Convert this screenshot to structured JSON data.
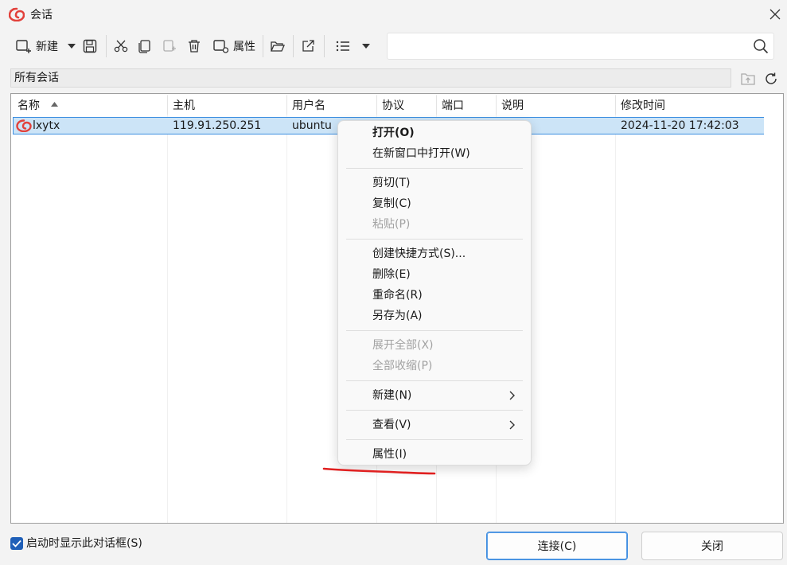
{
  "window": {
    "title": "会话",
    "accent_color": "#1f5fb8",
    "logo_icon": "xshell-shell-icon",
    "close_icon": "close-icon"
  },
  "toolbar": {
    "new_label": "新建",
    "properties_label": "属性",
    "search_value": "",
    "icons": [
      "new-session-icon",
      "dropdown-arrow-icon",
      "save-icon",
      "cut-icon",
      "copy-icon",
      "paste-icon",
      "delete-icon",
      "properties-icon",
      "open-folder-icon",
      "export-icon",
      "list-view-icon",
      "dropdown-arrow-icon",
      "search-icon"
    ]
  },
  "path_bar": {
    "label": "所有会话",
    "icons": [
      "up-folder-icon",
      "refresh-icon"
    ]
  },
  "table": {
    "columns": [
      "名称",
      "主机",
      "用户名",
      "协议",
      "端口",
      "说明",
      "修改时间"
    ],
    "sort_column": "名称",
    "sort_direction": "ascending",
    "rows": [
      {
        "name": "lxytx",
        "host": "119.91.250.251",
        "user": "ubuntu",
        "protocol": "",
        "port": "",
        "description": "",
        "modified": "2024-11-20 17:42:03",
        "icon": "xshell-session-icon",
        "selected": true
      }
    ]
  },
  "context_menu": {
    "items": [
      {
        "label": "打开(O)",
        "bold": true,
        "disabled": false
      },
      {
        "label": "在新窗口中打开(W)",
        "disabled": false
      },
      {
        "separator": true
      },
      {
        "label": "剪切(T)",
        "disabled": false
      },
      {
        "label": "复制(C)",
        "disabled": false
      },
      {
        "label": "粘贴(P)",
        "disabled": true
      },
      {
        "separator": true
      },
      {
        "label": "创建快捷方式(S)...",
        "disabled": false
      },
      {
        "label": "删除(E)",
        "disabled": false
      },
      {
        "label": "重命名(R)",
        "disabled": false
      },
      {
        "label": "另存为(A)",
        "disabled": false
      },
      {
        "separator": true
      },
      {
        "label": "展开全部(X)",
        "disabled": true
      },
      {
        "label": "全部收缩(P)",
        "disabled": true
      },
      {
        "separator": true
      },
      {
        "label": "新建(N)",
        "disabled": false,
        "submenu": true
      },
      {
        "separator": true
      },
      {
        "label": "查看(V)",
        "disabled": false,
        "submenu": true
      },
      {
        "separator": true
      },
      {
        "label": "属性(I)",
        "disabled": false
      }
    ]
  },
  "annotation": {
    "color": "#e02020"
  },
  "footer": {
    "checkbox_label": "启动时显示此对话框(S)",
    "checkbox_checked": true,
    "connect_label": "连接(C)",
    "close_label": "关闭"
  }
}
